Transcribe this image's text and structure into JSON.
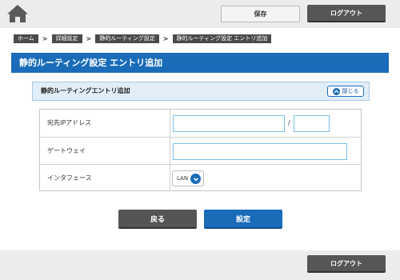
{
  "header": {
    "home_icon": "home-icon",
    "save_label": "保存",
    "logout_label": "ログアウト"
  },
  "breadcrumb": {
    "items": [
      "ホーム",
      "詳細設定",
      "静的ルーティング設定",
      "静的ルーティング設定 エントリ追加"
    ],
    "separator": ">"
  },
  "page": {
    "title": "静的ルーティング設定 エントリ追加"
  },
  "section": {
    "title": "静的ルーティングエントリ追加",
    "close_label": "閉じる"
  },
  "form": {
    "destination_label": "宛先IPアドレス",
    "ip_value": "",
    "mask_value": "",
    "mask_separator": "/",
    "gateway_label": "ゲートウェイ",
    "gateway_value": "",
    "interface_label": "インタフェース",
    "interface_selected": "LAN"
  },
  "actions": {
    "back_label": "戻る",
    "submit_label": "設定"
  },
  "footer": {
    "logout_label": "ログアウト"
  },
  "colors": {
    "accent": "#1a6cb9",
    "dark_button": "#565656",
    "bar_background": "#ececec",
    "input_border": "#7cc0e3",
    "section_background": "#e1eef8"
  }
}
